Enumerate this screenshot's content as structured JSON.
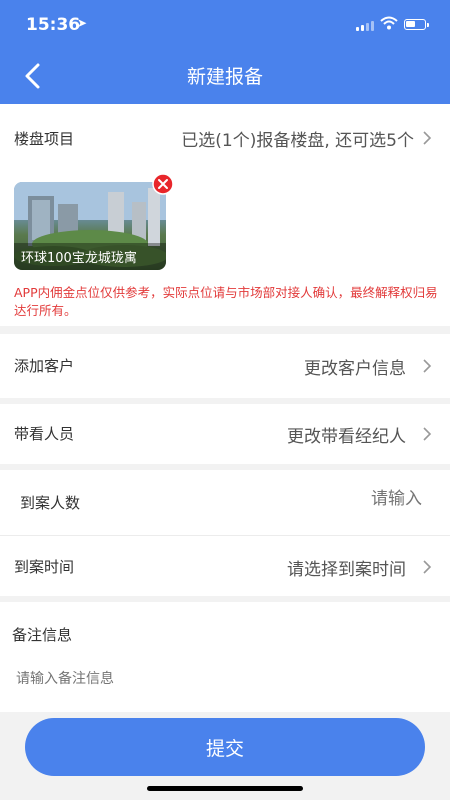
{
  "status_bar": {
    "time": "15:36"
  },
  "header": {
    "title": "新建报备"
  },
  "project": {
    "label": "楼盘项目",
    "value": "已选(1个)报备楼盘, 还可选5个",
    "selected": [
      {
        "name": "环球100宝龙城珑寓"
      }
    ]
  },
  "notice": "APP内佣金点位仅供参考，实际点位请与市场部对接人确认，最终解释权归易达行所有。",
  "customer": {
    "label": "添加客户",
    "value": "更改客户信息"
  },
  "companion": {
    "label": "带看人员",
    "value": "更改带看经纪人"
  },
  "visitor_count": {
    "label": "到案人数",
    "placeholder": "请输入"
  },
  "visit_time": {
    "label": "到案时间",
    "value": "请选择到案时间"
  },
  "remark": {
    "label": "备注信息",
    "placeholder": "请输入备注信息"
  },
  "submit": {
    "label": "提交"
  },
  "colors": {
    "accent": "#4a82ec",
    "warning": "#e23a3a",
    "remove": "#e8262b"
  }
}
